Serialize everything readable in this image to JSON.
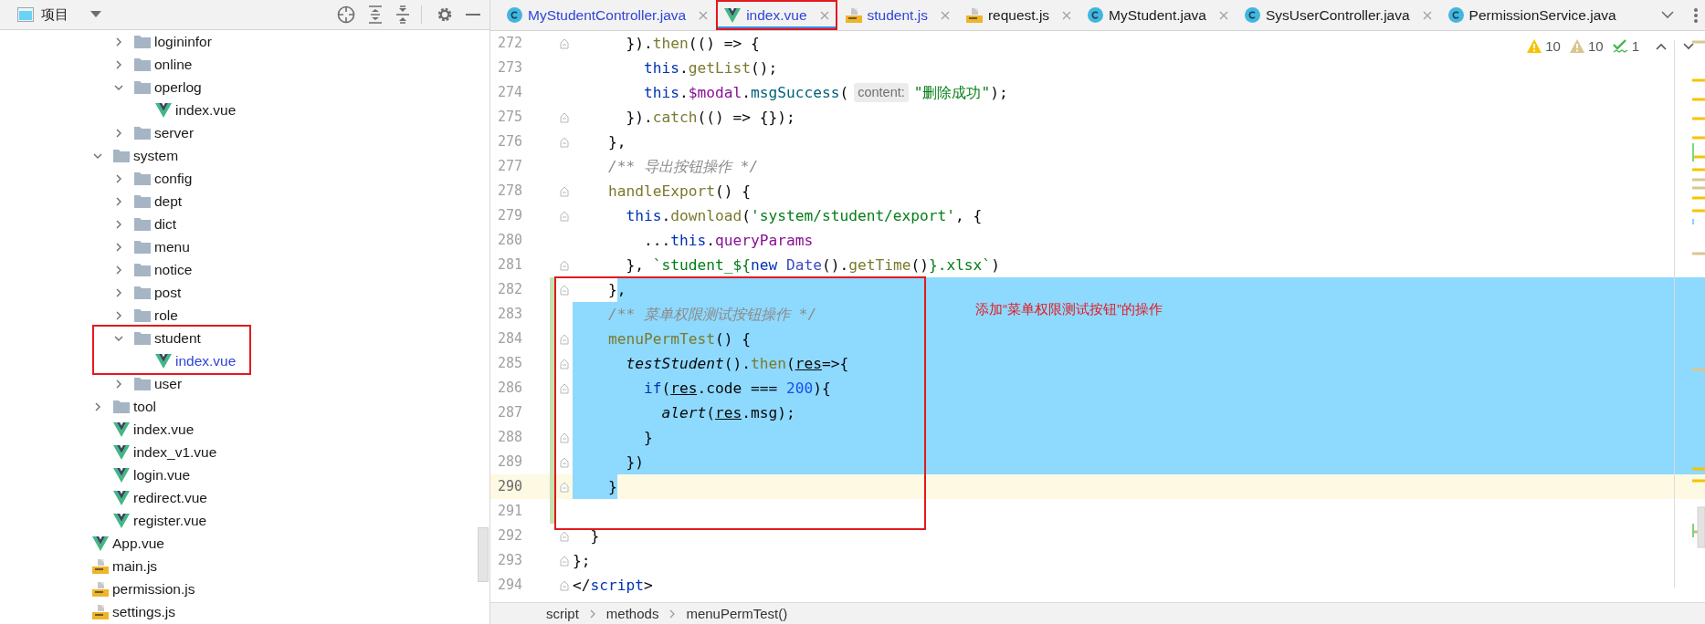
{
  "project_panel": {
    "title": "项目",
    "tree": [
      {
        "children": [
          {
            "children": [
              {
                "label": "logininfor",
                "kind": "folder",
                "expanded": false,
                "annotated": false
              },
              {
                "label": "online",
                "kind": "folder",
                "expanded": false,
                "annotated": false
              },
              {
                "label": "operlog",
                "kind": "folder",
                "expanded": true,
                "annotated": false,
                "children": [
                  {
                    "label": "index.vue",
                    "kind": "vue",
                    "modified": false,
                    "annotated": false
                  }
                ]
              },
              {
                "label": "server",
                "kind": "folder",
                "expanded": false,
                "annotated": false
              }
            ]
          },
          {
            "label": "system",
            "kind": "folder",
            "expanded": true,
            "annotated": false,
            "children": [
              {
                "label": "config",
                "kind": "folder",
                "expanded": false,
                "annotated": false
              },
              {
                "label": "dept",
                "kind": "folder",
                "expanded": false,
                "annotated": false
              },
              {
                "label": "dict",
                "kind": "folder",
                "expanded": false,
                "annotated": false
              },
              {
                "label": "menu",
                "kind": "folder",
                "expanded": false,
                "annotated": false
              },
              {
                "label": "notice",
                "kind": "folder",
                "expanded": false,
                "annotated": false
              },
              {
                "label": "post",
                "kind": "folder",
                "expanded": false,
                "annotated": false
              },
              {
                "label": "role",
                "kind": "folder",
                "expanded": false,
                "annotated": false
              },
              {
                "label": "student",
                "kind": "folder",
                "expanded": true,
                "annotated": true,
                "children": [
                  {
                    "label": "index.vue",
                    "kind": "vue",
                    "modified": true,
                    "annotated": false
                  }
                ]
              },
              {
                "label": "user",
                "kind": "folder",
                "expanded": false,
                "annotated": false
              }
            ]
          },
          {
            "label": "tool",
            "kind": "folder",
            "expanded": false,
            "annotated": false
          },
          {
            "label": "index.vue",
            "kind": "vue",
            "modified": false,
            "annotated": false
          },
          {
            "label": "index_v1.vue",
            "kind": "vue",
            "modified": false,
            "annotated": false
          },
          {
            "label": "login.vue",
            "kind": "vue",
            "modified": false,
            "annotated": false
          },
          {
            "label": "redirect.vue",
            "kind": "vue",
            "modified": false,
            "annotated": false
          },
          {
            "label": "register.vue",
            "kind": "vue",
            "modified": false,
            "annotated": false
          }
        ]
      },
      {
        "label": "App.vue",
        "kind": "vue",
        "modified": false,
        "annotated": false
      },
      {
        "label": "main.js",
        "kind": "js",
        "modified": false,
        "annotated": false
      },
      {
        "label": "permission.js",
        "kind": "js",
        "modified": false,
        "annotated": false
      },
      {
        "label": "settings.js",
        "kind": "js",
        "modified": false,
        "annotated": false
      }
    ]
  },
  "tabs": [
    {
      "label": "MyStudentController.java",
      "kind": "java",
      "selected": false,
      "modified": true,
      "closable": true,
      "annotated": false
    },
    {
      "label": "index.vue",
      "kind": "vue",
      "selected": true,
      "modified": true,
      "closable": true,
      "annotated": true
    },
    {
      "label": "student.js",
      "kind": "js",
      "selected": false,
      "modified": true,
      "closable": true,
      "annotated": false
    },
    {
      "label": "request.js",
      "kind": "js",
      "selected": false,
      "modified": false,
      "closable": true,
      "annotated": false
    },
    {
      "label": "MyStudent.java",
      "kind": "java",
      "selected": false,
      "modified": false,
      "closable": true,
      "annotated": false
    },
    {
      "label": "SysUserController.java",
      "kind": "java",
      "selected": false,
      "modified": false,
      "closable": true,
      "annotated": false
    },
    {
      "label": "PermissionService.java",
      "kind": "java",
      "selected": false,
      "modified": false,
      "closable": false,
      "annotated": false
    }
  ],
  "inspections": [
    {
      "kind": "warning",
      "count": "10"
    },
    {
      "kind": "weak",
      "count": "10"
    },
    {
      "kind": "typo",
      "count": "1"
    }
  ],
  "code_lines": [
    {
      "number": "272",
      "current": false,
      "changed": false,
      "fold_marker": true,
      "rest_selected": false,
      "segments": [
        {
          "text": "      }).",
          "kind": "plain",
          "selected": false
        },
        {
          "text": "then",
          "kind": "fn",
          "selected": false
        },
        {
          "text": "(() => {",
          "kind": "plain",
          "selected": false
        }
      ]
    },
    {
      "number": "273",
      "current": false,
      "changed": false,
      "fold_marker": false,
      "rest_selected": false,
      "segments": [
        {
          "text": "        this",
          "kind": "kw",
          "selected": false
        },
        {
          "text": ".",
          "kind": "plain",
          "selected": false
        },
        {
          "text": "getList",
          "kind": "fn",
          "selected": false
        },
        {
          "text": "();",
          "kind": "plain",
          "selected": false
        }
      ]
    },
    {
      "number": "274",
      "current": false,
      "changed": false,
      "fold_marker": false,
      "rest_selected": false,
      "segments": [
        {
          "text": "        this",
          "kind": "kw",
          "selected": false
        },
        {
          "text": ".",
          "kind": "plain",
          "selected": false
        },
        {
          "text": "$modal",
          "kind": "prop",
          "selected": false
        },
        {
          "text": ".",
          "kind": "plain",
          "selected": false
        },
        {
          "text": "msgSuccess",
          "kind": "call",
          "selected": false
        },
        {
          "text": "(",
          "kind": "plain",
          "selected": false
        },
        {
          "text": "content:",
          "kind": "hint",
          "selected": false
        },
        {
          "text": "\"删除成功\"",
          "kind": "str",
          "selected": false
        },
        {
          "text": ");",
          "kind": "plain",
          "selected": false
        }
      ]
    },
    {
      "number": "275",
      "current": false,
      "changed": false,
      "fold_marker": true,
      "rest_selected": false,
      "segments": [
        {
          "text": "      }).",
          "kind": "plain",
          "selected": false
        },
        {
          "text": "catch",
          "kind": "fn",
          "selected": false
        },
        {
          "text": "(() => {});",
          "kind": "plain",
          "selected": false
        }
      ]
    },
    {
      "number": "276",
      "current": false,
      "changed": false,
      "fold_marker": true,
      "rest_selected": false,
      "segments": [
        {
          "text": "    },",
          "kind": "plain",
          "selected": false
        }
      ]
    },
    {
      "number": "277",
      "current": false,
      "changed": false,
      "fold_marker": false,
      "rest_selected": false,
      "segments": [
        {
          "text": "    /** 导出按钮操作 */",
          "kind": "comment",
          "selected": false
        }
      ]
    },
    {
      "number": "278",
      "current": false,
      "changed": false,
      "fold_marker": true,
      "rest_selected": false,
      "segments": [
        {
          "text": "    handleExport",
          "kind": "fn",
          "selected": false
        },
        {
          "text": "() {",
          "kind": "plain",
          "selected": false
        }
      ]
    },
    {
      "number": "279",
      "current": false,
      "changed": false,
      "fold_marker": true,
      "rest_selected": false,
      "segments": [
        {
          "text": "      this",
          "kind": "kw",
          "selected": false
        },
        {
          "text": ".",
          "kind": "plain",
          "selected": false
        },
        {
          "text": "download",
          "kind": "fn",
          "selected": false
        },
        {
          "text": "(",
          "kind": "plain",
          "selected": false
        },
        {
          "text": "'system/student/export'",
          "kind": "str",
          "selected": false
        },
        {
          "text": ", {",
          "kind": "plain",
          "selected": false
        }
      ]
    },
    {
      "number": "280",
      "current": false,
      "changed": false,
      "fold_marker": false,
      "rest_selected": false,
      "segments": [
        {
          "text": "        ...",
          "kind": "plain",
          "selected": false
        },
        {
          "text": "this",
          "kind": "kw",
          "selected": false
        },
        {
          "text": ".",
          "kind": "plain",
          "selected": false
        },
        {
          "text": "queryParams",
          "kind": "prop",
          "selected": false
        }
      ]
    },
    {
      "number": "281",
      "current": false,
      "changed": false,
      "fold_marker": true,
      "rest_selected": false,
      "segments": [
        {
          "text": "      }, ",
          "kind": "plain",
          "selected": false
        },
        {
          "text": "`student_${",
          "kind": "str",
          "selected": false
        },
        {
          "text": "new",
          "kind": "kw",
          "selected": false
        },
        {
          "text": " Date",
          "kind": "cls",
          "selected": false
        },
        {
          "text": "().",
          "kind": "plain",
          "selected": false
        },
        {
          "text": "getTime",
          "kind": "fn",
          "selected": false
        },
        {
          "text": "()",
          "kind": "plain",
          "selected": false
        },
        {
          "text": "}.xlsx`",
          "kind": "str",
          "selected": false
        },
        {
          "text": ")",
          "kind": "plain",
          "selected": false
        }
      ]
    },
    {
      "number": "282",
      "current": false,
      "changed": true,
      "fold_marker": true,
      "rest_selected": true,
      "segments": [
        {
          "text": "    }",
          "kind": "plain",
          "selected": false
        },
        {
          "text": ",",
          "kind": "plain",
          "selected": true
        }
      ]
    },
    {
      "number": "283",
      "current": false,
      "changed": true,
      "fold_marker": false,
      "rest_selected": true,
      "segments": [
        {
          "text": "    /** 菜单权限测试按钮操作 */",
          "kind": "comment",
          "selected": true
        }
      ]
    },
    {
      "number": "284",
      "current": false,
      "changed": true,
      "fold_marker": true,
      "rest_selected": true,
      "segments": [
        {
          "text": "    menuPermTest",
          "kind": "fn",
          "selected": true
        },
        {
          "text": "() {",
          "kind": "plain",
          "selected": true
        }
      ]
    },
    {
      "number": "285",
      "current": false,
      "changed": true,
      "fold_marker": true,
      "rest_selected": true,
      "segments": [
        {
          "text": "      testStudent",
          "kind": "ital",
          "selected": true
        },
        {
          "text": "().",
          "kind": "plain",
          "selected": true
        },
        {
          "text": "then",
          "kind": "fn",
          "selected": true
        },
        {
          "text": "(",
          "kind": "plain",
          "selected": true
        },
        {
          "text": "res",
          "kind": "var",
          "selected": true
        },
        {
          "text": "=>{",
          "kind": "plain",
          "selected": true
        }
      ]
    },
    {
      "number": "286",
      "current": false,
      "changed": true,
      "fold_marker": true,
      "rest_selected": true,
      "segments": [
        {
          "text": "        if",
          "kind": "kw",
          "selected": true
        },
        {
          "text": "(",
          "kind": "plain",
          "selected": true
        },
        {
          "text": "res",
          "kind": "var",
          "selected": true
        },
        {
          "text": ".code === ",
          "kind": "plain",
          "selected": true
        },
        {
          "text": "200",
          "kind": "num",
          "selected": true
        },
        {
          "text": "){",
          "kind": "plain",
          "selected": true
        }
      ]
    },
    {
      "number": "287",
      "current": false,
      "changed": true,
      "fold_marker": false,
      "rest_selected": true,
      "segments": [
        {
          "text": "          alert",
          "kind": "ital",
          "selected": true
        },
        {
          "text": "(",
          "kind": "plain",
          "selected": true
        },
        {
          "text": "res",
          "kind": "var",
          "selected": true
        },
        {
          "text": ".msg);",
          "kind": "plain",
          "selected": true
        }
      ]
    },
    {
      "number": "288",
      "current": false,
      "changed": true,
      "fold_marker": true,
      "rest_selected": true,
      "segments": [
        {
          "text": "        }",
          "kind": "plain",
          "selected": true
        }
      ]
    },
    {
      "number": "289",
      "current": false,
      "changed": true,
      "fold_marker": true,
      "rest_selected": true,
      "segments": [
        {
          "text": "      })",
          "kind": "plain",
          "selected": true
        }
      ]
    },
    {
      "number": "290",
      "current": true,
      "changed": true,
      "fold_marker": true,
      "rest_selected": false,
      "segments": [
        {
          "text": "    }",
          "kind": "plain",
          "selected": true
        }
      ]
    },
    {
      "number": "291",
      "current": false,
      "changed": true,
      "fold_marker": false,
      "rest_selected": false
    },
    {
      "number": "292",
      "current": false,
      "changed": false,
      "fold_marker": true,
      "rest_selected": false,
      "segments": [
        {
          "text": "  }",
          "kind": "plain",
          "selected": false
        }
      ]
    },
    {
      "number": "293",
      "current": false,
      "changed": false,
      "fold_marker": true,
      "rest_selected": false,
      "segments": [
        {
          "text": "};",
          "kind": "plain",
          "selected": false
        }
      ]
    },
    {
      "number": "294",
      "current": false,
      "changed": false,
      "fold_marker": true,
      "rest_selected": false,
      "segments": [
        {
          "text": "</",
          "kind": "plain",
          "selected": false
        },
        {
          "text": "script",
          "kind": "tag",
          "selected": false
        },
        {
          "text": ">",
          "kind": "plain",
          "selected": false
        }
      ]
    }
  ],
  "annotation": {
    "note": "添加“菜单权限测试按钮”的操作"
  },
  "breadcrumbs": [
    "script",
    "methods",
    "menuPermTest()"
  ]
}
